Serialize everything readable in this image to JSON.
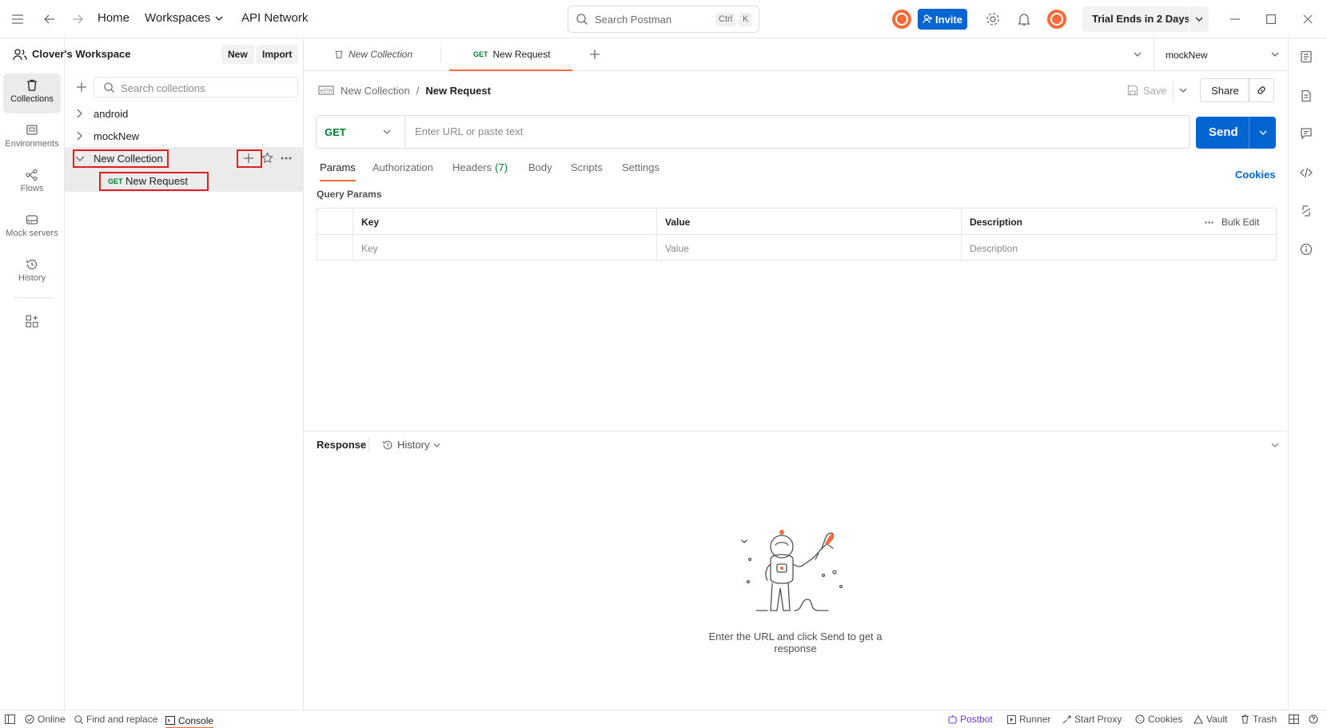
{
  "topbar": {
    "home": "Home",
    "workspaces": "Workspaces",
    "api_network": "API Network",
    "search_placeholder": "Search Postman",
    "kbd_ctrl": "Ctrl",
    "kbd_k": "K",
    "invite": "Invite",
    "trial": "Trial Ends in 2 Days"
  },
  "rail": {
    "collections": "Collections",
    "environments": "Environments",
    "flows": "Flows",
    "mock_servers": "Mock servers",
    "history": "History"
  },
  "sidebar": {
    "workspace_title": "Clover's Workspace",
    "new_button": "New",
    "import_button": "Import",
    "search_placeholder": "Search collections",
    "items": [
      {
        "label": "android"
      },
      {
        "label": "mockNew"
      },
      {
        "label": "New Collection"
      }
    ],
    "request": {
      "method": "GET",
      "label": "New Request"
    }
  },
  "tabs": {
    "collection_tab": "New Collection",
    "request_method": "GET",
    "request_tab": "New Request",
    "environment": "mockNew"
  },
  "request": {
    "breadcrumb_parent": "New Collection",
    "breadcrumb_sep": "/",
    "breadcrumb_current": "New Request",
    "save": "Save",
    "share": "Share",
    "method": "GET",
    "url_placeholder": "Enter URL or paste text",
    "send": "Send",
    "tabs": [
      "Params",
      "Authorization",
      "Headers",
      "Body",
      "Scripts",
      "Settings"
    ],
    "headers_count": "(7)",
    "cookies": "Cookies",
    "query_params_title": "Query Params",
    "columns": {
      "key": "Key",
      "value": "Value",
      "description": "Description"
    },
    "bulk_edit": "Bulk Edit",
    "placeholders": {
      "key": "Key",
      "value": "Value",
      "description": "Description"
    }
  },
  "response": {
    "title": "Response",
    "history": "History",
    "empty_message": "Enter the URL and click Send to get a response"
  },
  "statusbar": {
    "online": "Online",
    "find_replace": "Find and replace",
    "console": "Console",
    "postbot": "Postbot",
    "runner": "Runner",
    "start_proxy": "Start Proxy",
    "cookies": "Cookies",
    "vault": "Vault",
    "trash": "Trash"
  },
  "colors": {
    "accent": "#f26b3a",
    "primary": "#0265d2",
    "get_method": "#007f31",
    "annotation_box": "#e31d1d"
  }
}
